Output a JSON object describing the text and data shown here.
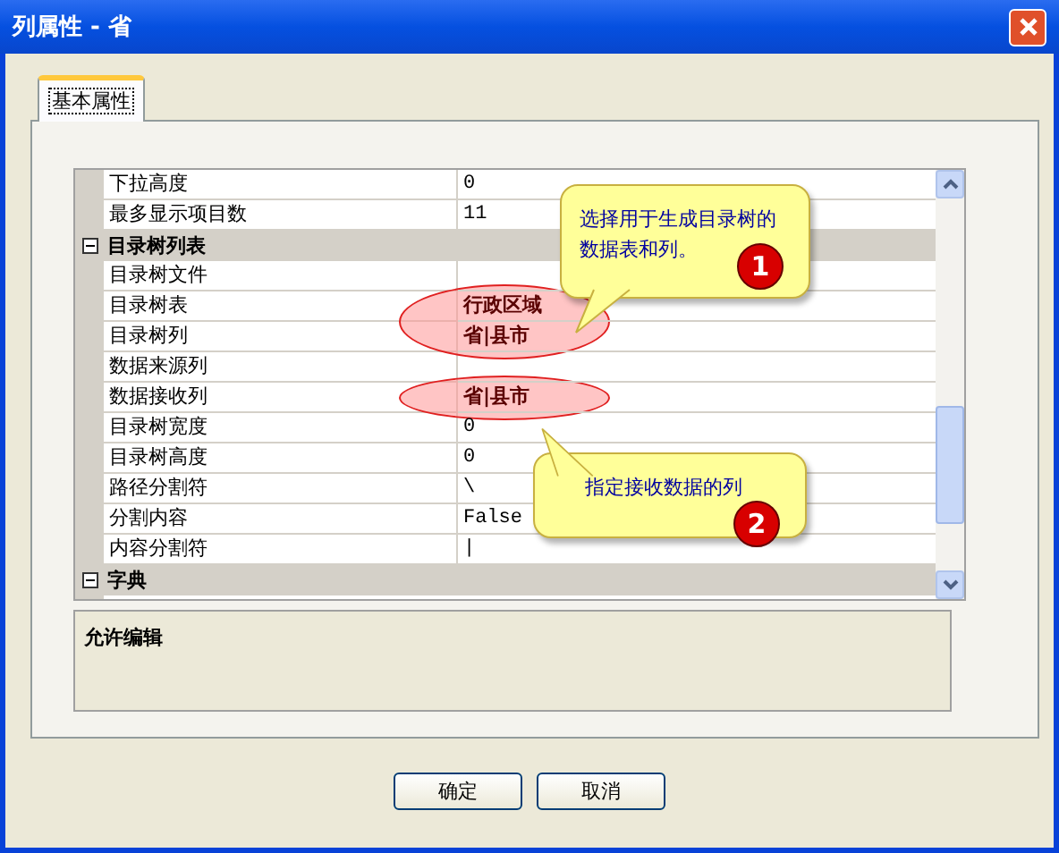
{
  "window": {
    "title": "列属性 - 省"
  },
  "tabs": [
    {
      "label": "基本属性",
      "selected": true
    }
  ],
  "grid": {
    "rows": [
      {
        "kind": "property",
        "name": "下拉高度",
        "value": "0",
        "highlighted": false
      },
      {
        "kind": "property",
        "name": "最多显示项目数",
        "value": "11",
        "highlighted": false
      },
      {
        "kind": "category",
        "name": "目录树列表",
        "expanded": true
      },
      {
        "kind": "property",
        "name": "目录树文件",
        "value": "",
        "highlighted": false
      },
      {
        "kind": "property",
        "name": "目录树表",
        "value": "行政区域",
        "highlighted": true
      },
      {
        "kind": "property",
        "name": "目录树列",
        "value": "省|县市",
        "highlighted": true
      },
      {
        "kind": "property",
        "name": "数据来源列",
        "value": "",
        "highlighted": false
      },
      {
        "kind": "property",
        "name": "数据接收列",
        "value": "省|县市",
        "highlighted": true
      },
      {
        "kind": "property",
        "name": "目录树宽度",
        "value": "0",
        "highlighted": false
      },
      {
        "kind": "property",
        "name": "目录树高度",
        "value": "0",
        "highlighted": false
      },
      {
        "kind": "property",
        "name": "路径分割符",
        "value": "\\",
        "highlighted": false
      },
      {
        "kind": "property",
        "name": "分割内容",
        "value": "False",
        "highlighted": false
      },
      {
        "kind": "property",
        "name": "内容分割符",
        "value": "|",
        "highlighted": false
      },
      {
        "kind": "category",
        "name": "字典",
        "expanded": true
      }
    ]
  },
  "callouts": [
    {
      "text": "选择用于生成目录树的数据表和列。",
      "number": "1"
    },
    {
      "text": "指定接收数据的列",
      "number": "2"
    }
  ],
  "description": {
    "title": "允许编辑"
  },
  "buttons": [
    "确定",
    "取消"
  ]
}
